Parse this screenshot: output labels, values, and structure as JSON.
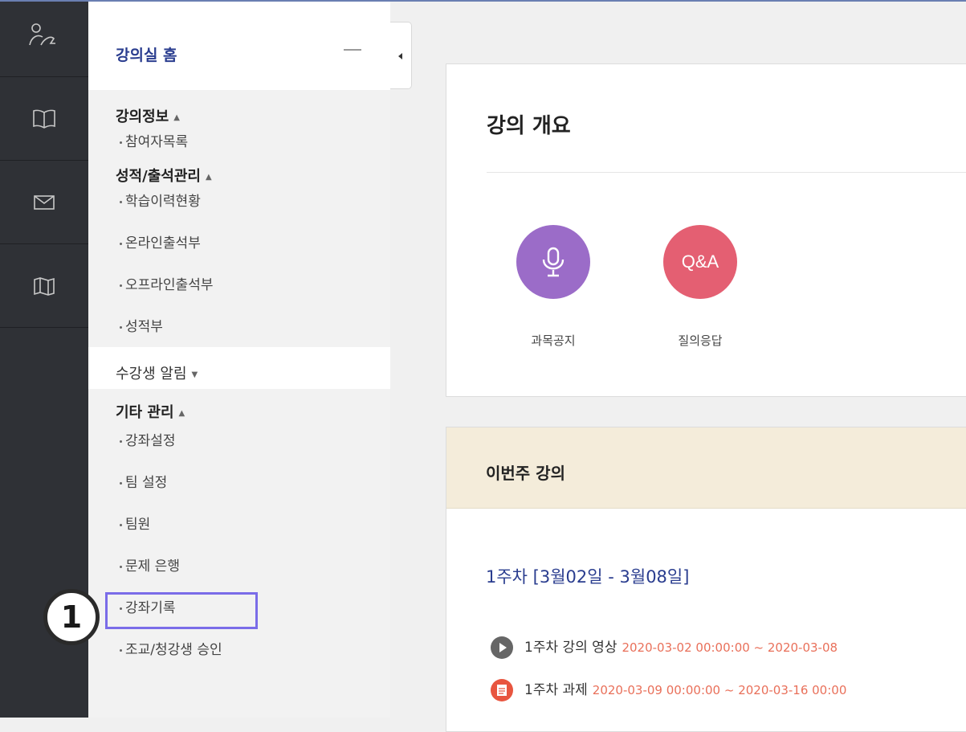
{
  "sidebar": {
    "home_title": "강의실 홈",
    "sections": [
      {
        "label": "강의정보",
        "caret": "▲",
        "items": [
          "참여자목록"
        ]
      },
      {
        "label": "성적/출석관리",
        "caret": "▲",
        "items": [
          "학습이력현황",
          "온라인출석부",
          "오프라인출석부",
          "성적부"
        ]
      },
      {
        "label": "수강생 알림",
        "caret": "▼",
        "items": []
      },
      {
        "label": "기타 관리",
        "caret": "▲",
        "items": [
          "강좌설정",
          "팀 설정",
          "팀원",
          "문제 은행",
          "강좌기록",
          "조교/청강생 승인"
        ]
      }
    ]
  },
  "annotation": {
    "number": "1",
    "color": "#7a6ce8"
  },
  "overview": {
    "title": "강의 개요",
    "tiles": [
      {
        "label": "과목공지",
        "icon": "microphone-icon",
        "color": "#9b6cc8"
      },
      {
        "label": "질의응답",
        "icon_text": "Q&A",
        "color": "#e45f72"
      }
    ]
  },
  "this_week": {
    "title": "이번주 강의",
    "week_title": "1주차 [3월02일 - 3월08일]",
    "activities": [
      {
        "name": "1주차 강의 영상",
        "date": "2020-03-02 00:00:00 ~ 2020-03-08",
        "icon": "play-icon"
      },
      {
        "name": "1주차 과제",
        "date": "2020-03-09 00:00:00 ~ 2020-03-16 00:00",
        "icon": "assignment-icon"
      }
    ]
  }
}
